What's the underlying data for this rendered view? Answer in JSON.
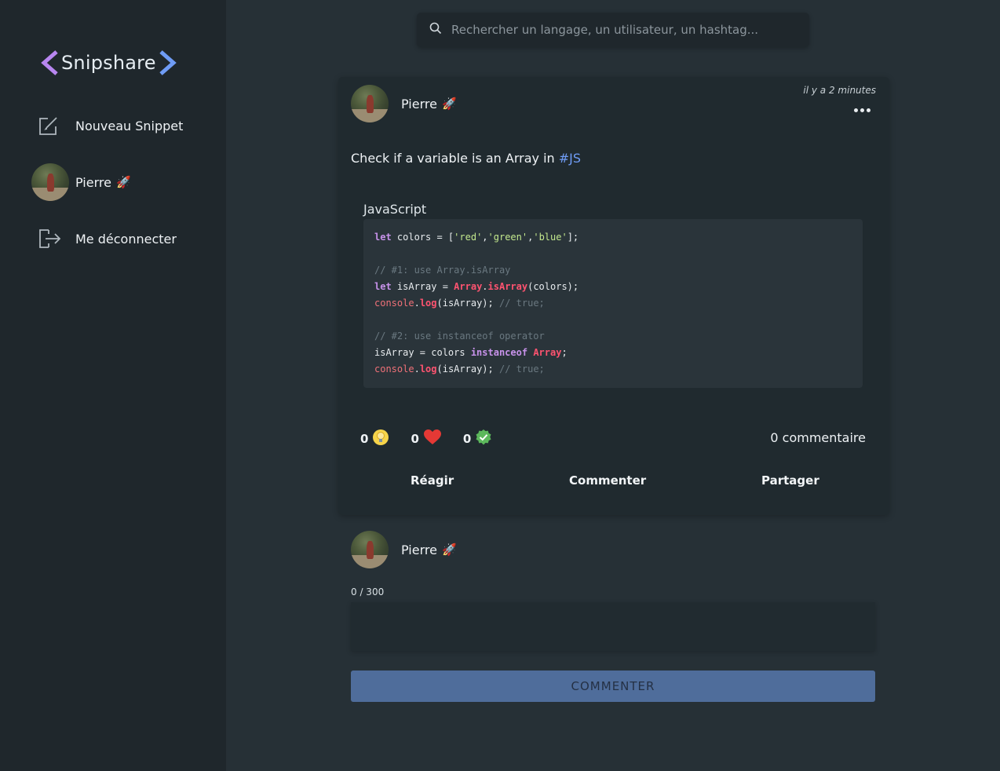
{
  "sidebar": {
    "logo_text": "Snipshare",
    "items": [
      {
        "label": "Nouveau Snippet",
        "icon": "edit-icon"
      },
      {
        "label": "Pierre",
        "icon": "avatar"
      },
      {
        "label": "Me déconnecter",
        "icon": "logout-icon"
      }
    ],
    "rocket": "🚀"
  },
  "search": {
    "placeholder": "Rechercher un langage, un utilisateur, un hashtag..."
  },
  "post": {
    "author": "Pierre",
    "author_emoji": "🚀",
    "timestamp": "il y a 2 minutes",
    "text": "Check if a variable is an Array in ",
    "hashtag": "#JS",
    "language": "JavaScript",
    "code_lines": [
      "let colors = ['red','green','blue'];",
      "",
      "// #1: use Array.isArray",
      "let isArray = Array.isArray(colors);",
      "console.log(isArray); // true;",
      "",
      "// #2: use instanceof operator",
      "isArray = colors instanceof Array;",
      "console.log(isArray); // true;"
    ],
    "reactions": [
      {
        "name": "idea",
        "count": "0",
        "icon": "lightbulb-icon"
      },
      {
        "name": "love",
        "count": "0",
        "icon": "heart-icon"
      },
      {
        "name": "approve",
        "count": "0",
        "icon": "check-badge-icon"
      }
    ],
    "comment_count": "0 commentaire",
    "actions": {
      "react": "Réagir",
      "comment": "Commenter",
      "share": "Partager"
    }
  },
  "comment_form": {
    "author": "Pierre",
    "author_emoji": "🚀",
    "char_count": "0 / 300",
    "value": "",
    "submit_label": "COMMENTER"
  },
  "colors": {
    "background": "#263036",
    "sidebar": "#1f272c",
    "card": "#202a2f",
    "accent_blue": "#6f9cf5",
    "submit_button": "#4f6d9b",
    "logo_left_bracket": "#b886f0",
    "logo_right_bracket": "#6f9cf5"
  }
}
